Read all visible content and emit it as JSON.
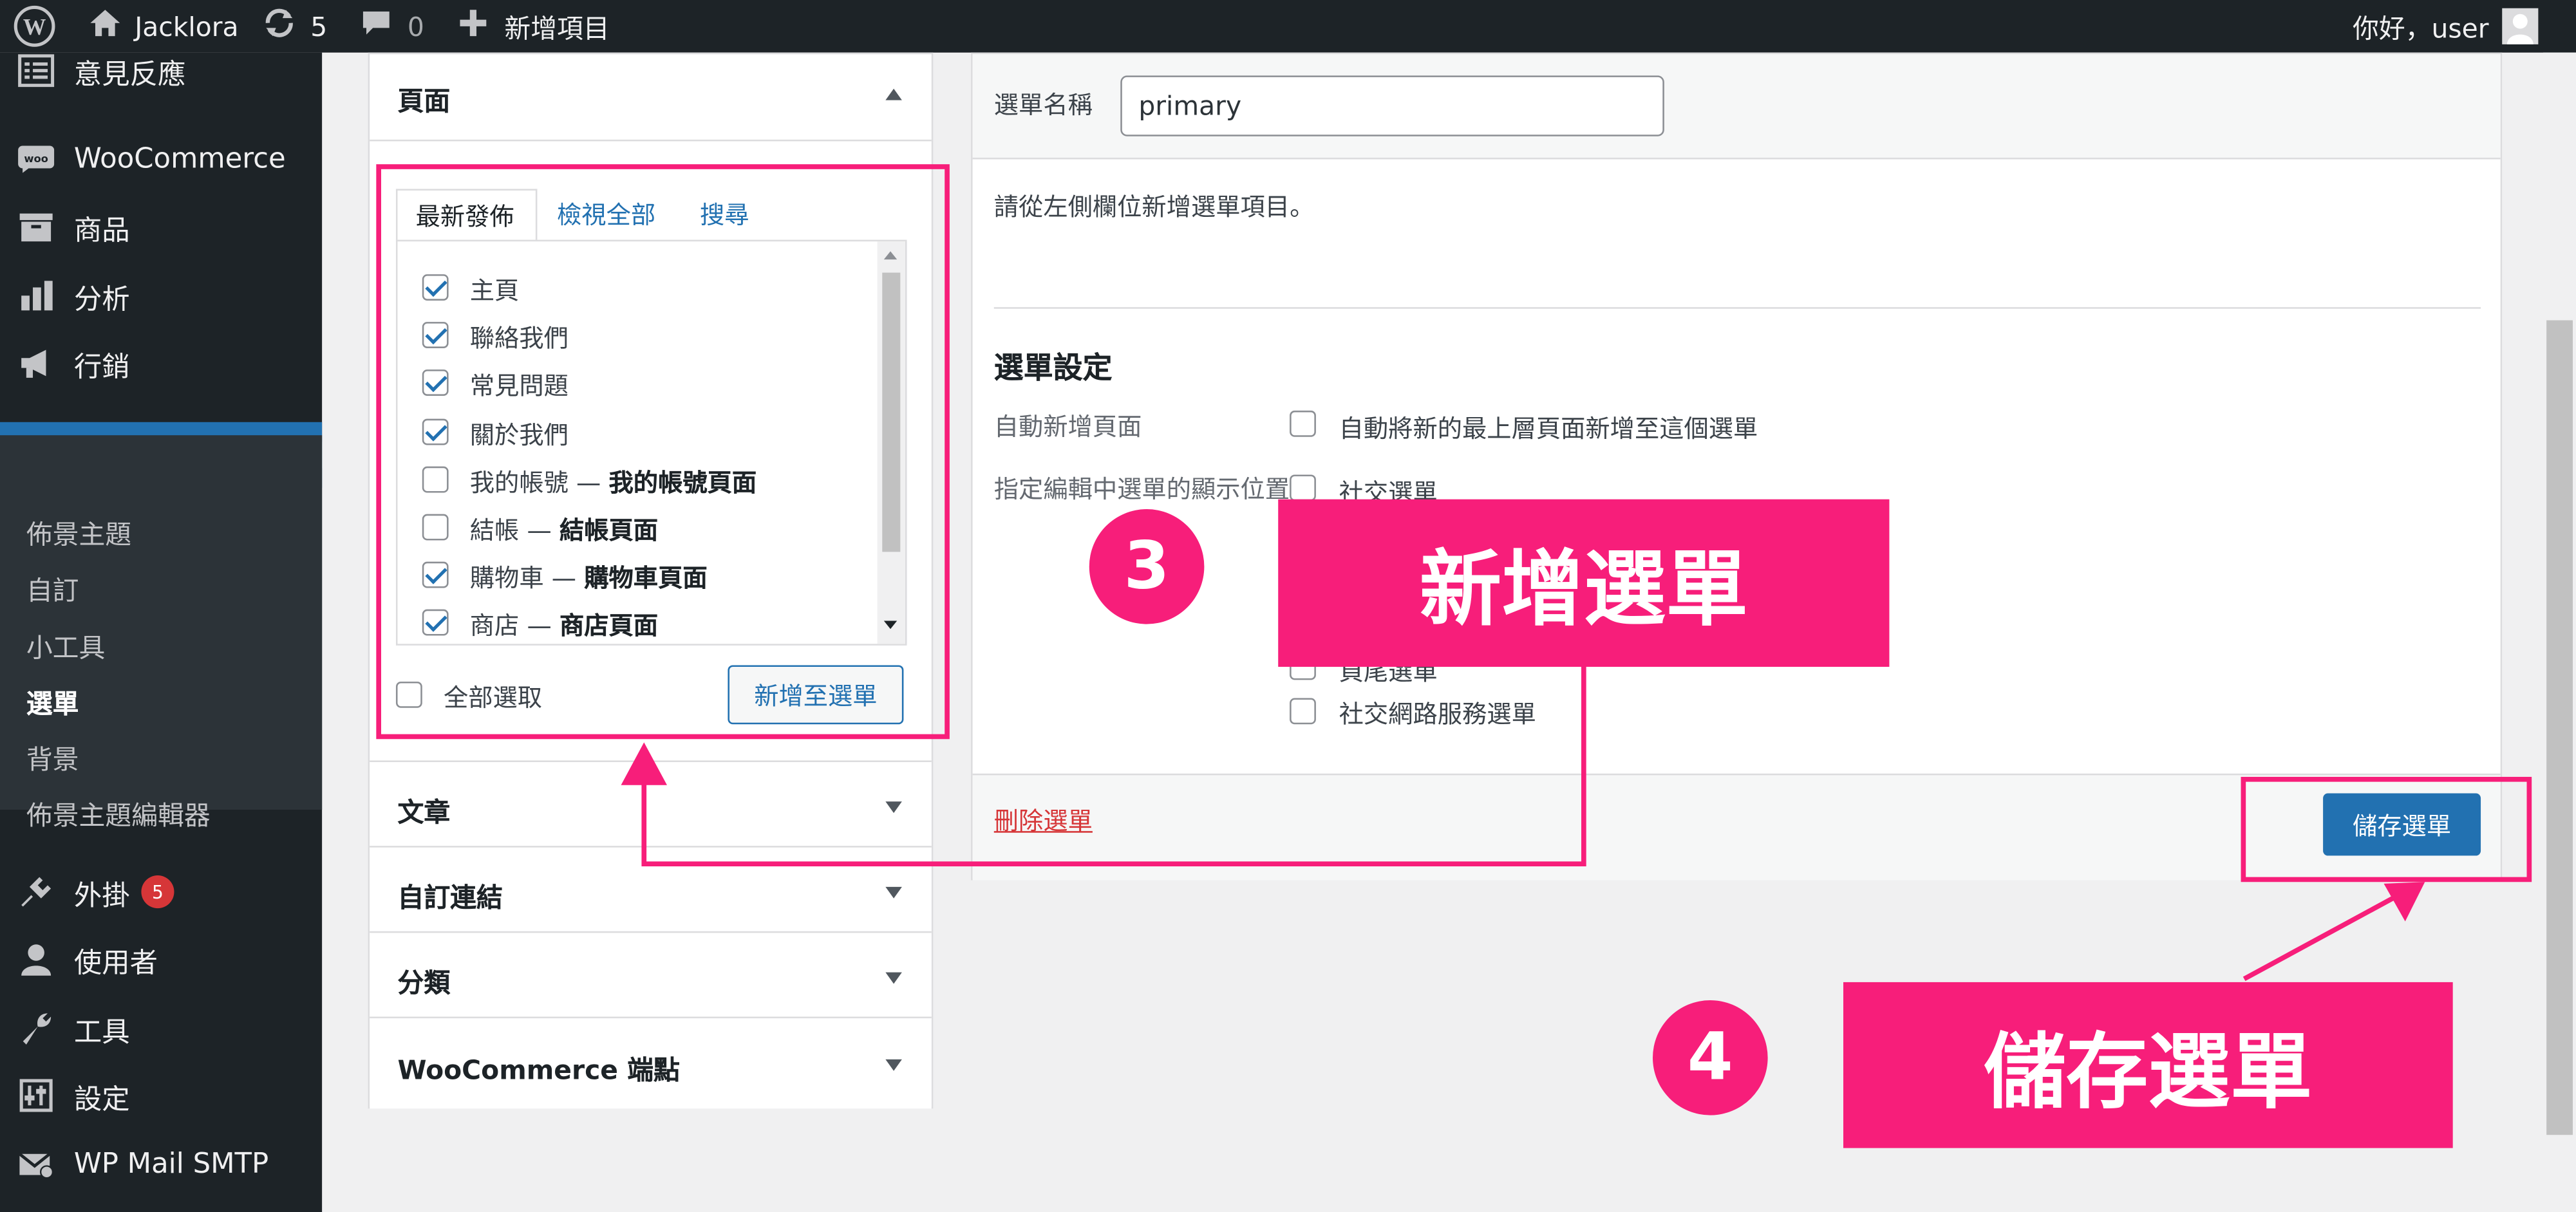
{
  "adminbar": {
    "site_name": "Jacklora",
    "updates_count": "5",
    "comments_count": "0",
    "new_label": "新增項目",
    "greeting": "你好，user"
  },
  "sidebar": {
    "feedback": "意見反應",
    "woocommerce": "WooCommerce",
    "products": "商品",
    "analytics": "分析",
    "marketing": "行銷",
    "appearance": "外觀",
    "sub": {
      "themes": "佈景主題",
      "customize": "自訂",
      "widgets": "小工具",
      "menus": "選單",
      "background": "背景",
      "theme_editor": "佈景主題編輯器"
    },
    "plugins": "外掛",
    "plugins_badge": "5",
    "users": "使用者",
    "tools": "工具",
    "settings": "設定",
    "wp_mail_smtp": "WP Mail SMTP"
  },
  "left_panel": {
    "pages_title": "頁面",
    "tabs": [
      "最新發佈",
      "檢視全部",
      "搜尋"
    ],
    "pages": [
      {
        "label": "主頁",
        "suffix": "",
        "checked": true
      },
      {
        "label": "聯絡我們",
        "suffix": "",
        "checked": true
      },
      {
        "label": "常見問題",
        "suffix": "",
        "checked": true
      },
      {
        "label": "關於我們",
        "suffix": "",
        "checked": true
      },
      {
        "label": "我的帳號 — ",
        "suffix": "我的帳號頁面",
        "checked": false
      },
      {
        "label": "結帳 — ",
        "suffix": "結帳頁面",
        "checked": false
      },
      {
        "label": "購物車 — ",
        "suffix": "購物車頁面",
        "checked": true
      },
      {
        "label": "商店 — ",
        "suffix": "商店頁面",
        "checked": true
      }
    ],
    "select_all": "全部選取",
    "add_to_menu": "新增至選單",
    "posts_title": "文章",
    "custom_links_title": "自訂連結",
    "categories_title": "分類",
    "woo_endpoints_title": "WooCommerce 端點"
  },
  "menu_editor": {
    "name_label": "選單名稱",
    "name_value": "primary",
    "instructions": "請從左側欄位新增選單項目。",
    "settings_title": "選單設定",
    "auto_add_label": "自動新增頁面",
    "auto_add_option": "自動將新的最上層頁面新增至這個選單",
    "location_label": "指定編輯中選單的顯示位置",
    "locations": [
      "社交選單",
      "頁尾選單",
      "社交網路服務選單"
    ],
    "delete_link": "刪除選單",
    "save_button": "儲存選單"
  },
  "annotations": {
    "step3_number": "3",
    "step3_label": "新增選單",
    "step4_number": "4",
    "step4_label": "儲存選單"
  },
  "colors": {
    "accent_pink": "#f71e7a",
    "wp_blue": "#2271b1",
    "admin_dark": "#1d2327"
  }
}
